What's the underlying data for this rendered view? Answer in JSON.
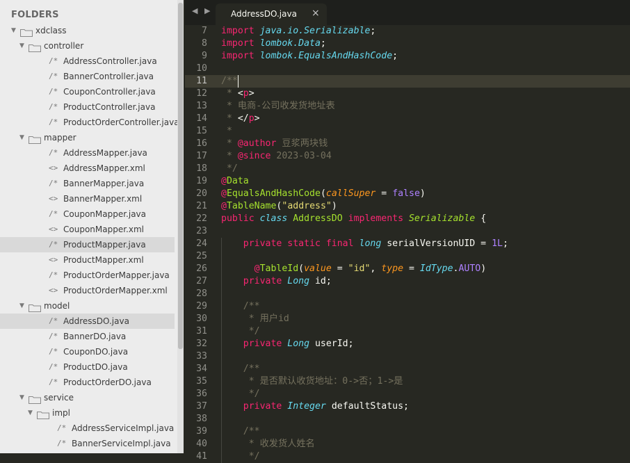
{
  "sidebar": {
    "title": "FOLDERS",
    "tree": [
      {
        "label": "xdclass",
        "kind": "folder",
        "depth": 0,
        "open": true
      },
      {
        "label": "controller",
        "kind": "folder",
        "depth": 1,
        "open": true
      },
      {
        "label": "AddressController.java",
        "kind": "java",
        "depth": 2
      },
      {
        "label": "BannerController.java",
        "kind": "java",
        "depth": 2
      },
      {
        "label": "CouponController.java",
        "kind": "java",
        "depth": 2
      },
      {
        "label": "ProductController.java",
        "kind": "java",
        "depth": 2
      },
      {
        "label": "ProductOrderController.java",
        "kind": "java",
        "depth": 2
      },
      {
        "label": "mapper",
        "kind": "folder",
        "depth": 1,
        "open": true
      },
      {
        "label": "AddressMapper.java",
        "kind": "java",
        "depth": 2
      },
      {
        "label": "AddressMapper.xml",
        "kind": "xml",
        "depth": 2
      },
      {
        "label": "BannerMapper.java",
        "kind": "java",
        "depth": 2
      },
      {
        "label": "BannerMapper.xml",
        "kind": "xml",
        "depth": 2
      },
      {
        "label": "CouponMapper.java",
        "kind": "java",
        "depth": 2
      },
      {
        "label": "CouponMapper.xml",
        "kind": "xml",
        "depth": 2
      },
      {
        "label": "ProductMapper.java",
        "kind": "java",
        "depth": 2,
        "highlighted": true
      },
      {
        "label": "ProductMapper.xml",
        "kind": "xml",
        "depth": 2
      },
      {
        "label": "ProductOrderMapper.java",
        "kind": "java",
        "depth": 2
      },
      {
        "label": "ProductOrderMapper.xml",
        "kind": "xml",
        "depth": 2
      },
      {
        "label": "model",
        "kind": "folder",
        "depth": 1,
        "open": true
      },
      {
        "label": "AddressDO.java",
        "kind": "java",
        "depth": 2,
        "highlighted": true
      },
      {
        "label": "BannerDO.java",
        "kind": "java",
        "depth": 2
      },
      {
        "label": "CouponDO.java",
        "kind": "java",
        "depth": 2
      },
      {
        "label": "ProductDO.java",
        "kind": "java",
        "depth": 2
      },
      {
        "label": "ProductOrderDO.java",
        "kind": "java",
        "depth": 2
      },
      {
        "label": "service",
        "kind": "folder",
        "depth": 1,
        "open": true
      },
      {
        "label": "impl",
        "kind": "folder",
        "depth": 2,
        "open": true
      },
      {
        "label": "AddressServiceImpl.java",
        "kind": "java",
        "depth": 3
      },
      {
        "label": "BannerServiceImpl.java",
        "kind": "java",
        "depth": 3
      }
    ],
    "icons": {
      "java": "/*",
      "xml": "<>",
      "folder": "folder-icon",
      "disclosure": "disclosure-open-icon"
    }
  },
  "tabbar": {
    "nav_glyphs": "◀ ▶",
    "active_tab": "AddressDO.java",
    "close_glyph": "×"
  },
  "editor": {
    "colors": {
      "background": "#272822",
      "text": "#f8f8f2",
      "keyword": "#f92672",
      "type": "#66d9ef",
      "comment": "#75715e",
      "string": "#e6db74",
      "number": "#ae81ff",
      "function": "#a6e22e",
      "param": "#fd971f"
    },
    "current_line": 11,
    "lines": [
      {
        "n": "7",
        "t": [
          [
            "import ",
            "kw"
          ],
          [
            "java.io.",
            "tyi"
          ],
          [
            "Serializable",
            "tyi"
          ],
          [
            ";",
            ""
          ]
        ]
      },
      {
        "n": "8",
        "t": [
          [
            "import ",
            "kw"
          ],
          [
            "lombok.",
            "tyi"
          ],
          [
            "Data",
            "tyi"
          ],
          [
            ";",
            ""
          ]
        ]
      },
      {
        "n": "9",
        "t": [
          [
            "import ",
            "kw"
          ],
          [
            "lombok.",
            "tyi"
          ],
          [
            "EqualsAndHashCode",
            "tyi"
          ],
          [
            ";",
            ""
          ]
        ]
      },
      {
        "n": "10",
        "t": []
      },
      {
        "n": "11",
        "t": [
          [
            "/**",
            "cm"
          ]
        ]
      },
      {
        "n": "12",
        "t": [
          [
            " * ",
            "cm"
          ],
          [
            "<",
            ""
          ],
          [
            "p",
            "kw"
          ],
          [
            ">",
            ""
          ]
        ]
      },
      {
        "n": "13",
        "t": [
          [
            " * 电商-公司收发货地址表",
            "cm"
          ]
        ]
      },
      {
        "n": "14",
        "t": [
          [
            " * ",
            "cm"
          ],
          [
            "</",
            ""
          ],
          [
            "p",
            "kw"
          ],
          [
            ">",
            ""
          ]
        ]
      },
      {
        "n": "15",
        "t": [
          [
            " *",
            "cm"
          ]
        ]
      },
      {
        "n": "16",
        "t": [
          [
            " * ",
            "cm"
          ],
          [
            "@author",
            "kw"
          ],
          [
            " 豆浆两块钱",
            "cm"
          ]
        ]
      },
      {
        "n": "17",
        "t": [
          [
            " * ",
            "cm"
          ],
          [
            "@since",
            "kw"
          ],
          [
            " 2023-03-04",
            "cm"
          ]
        ]
      },
      {
        "n": "18",
        "t": [
          [
            " */",
            "cm"
          ]
        ]
      },
      {
        "n": "19",
        "t": [
          [
            "@",
            "kw"
          ],
          [
            "Data",
            "fn"
          ]
        ]
      },
      {
        "n": "20",
        "t": [
          [
            "@",
            "kw"
          ],
          [
            "EqualsAndHashCode",
            "fn"
          ],
          [
            "(",
            ""
          ],
          [
            "callSuper",
            "pri"
          ],
          [
            " = ",
            ""
          ],
          [
            "false",
            "num"
          ],
          [
            ")",
            ""
          ]
        ]
      },
      {
        "n": "21",
        "t": [
          [
            "@",
            "kw"
          ],
          [
            "TableName",
            "fn"
          ],
          [
            "(",
            ""
          ],
          [
            "\"address\"",
            "str"
          ],
          [
            ")",
            ""
          ]
        ]
      },
      {
        "n": "22",
        "t": [
          [
            "public ",
            "kw"
          ],
          [
            "class ",
            "tyi"
          ],
          [
            "AddressDO ",
            "fn"
          ],
          [
            "implements ",
            "kw"
          ],
          [
            "Serializable",
            "fni"
          ],
          [
            " {",
            ""
          ]
        ]
      },
      {
        "n": "23",
        "t": []
      },
      {
        "n": "24",
        "t": [
          [
            "    private ",
            "kw"
          ],
          [
            "static ",
            "kw"
          ],
          [
            "final ",
            "kw"
          ],
          [
            "long ",
            "tyi"
          ],
          [
            "serialVersionUID = ",
            ""
          ],
          [
            "1L",
            "num"
          ],
          [
            ";",
            ""
          ]
        ]
      },
      {
        "n": "25",
        "t": []
      },
      {
        "n": "26",
        "t": [
          [
            "      @",
            "kw"
          ],
          [
            "TableId",
            "fn"
          ],
          [
            "(",
            ""
          ],
          [
            "value",
            "pri"
          ],
          [
            " = ",
            ""
          ],
          [
            "\"id\"",
            "str"
          ],
          [
            ", ",
            ""
          ],
          [
            "type",
            "pri"
          ],
          [
            " = ",
            ""
          ],
          [
            "IdType",
            "tyi"
          ],
          [
            ".",
            ""
          ],
          [
            "AUTO",
            "num"
          ],
          [
            ")",
            ""
          ]
        ]
      },
      {
        "n": "27",
        "t": [
          [
            "    private ",
            "kw"
          ],
          [
            "Long ",
            "tyi"
          ],
          [
            "id;",
            ""
          ]
        ]
      },
      {
        "n": "28",
        "t": []
      },
      {
        "n": "29",
        "t": [
          [
            "    /**",
            "cm"
          ]
        ]
      },
      {
        "n": "30",
        "t": [
          [
            "     * 用户id",
            "cm"
          ]
        ]
      },
      {
        "n": "31",
        "t": [
          [
            "     */",
            "cm"
          ]
        ]
      },
      {
        "n": "32",
        "t": [
          [
            "    private ",
            "kw"
          ],
          [
            "Long ",
            "tyi"
          ],
          [
            "userId;",
            ""
          ]
        ]
      },
      {
        "n": "33",
        "t": []
      },
      {
        "n": "34",
        "t": [
          [
            "    /**",
            "cm"
          ]
        ]
      },
      {
        "n": "35",
        "t": [
          [
            "     * 是否默认收货地址：0->否；1->是",
            "cm"
          ]
        ]
      },
      {
        "n": "36",
        "t": [
          [
            "     */",
            "cm"
          ]
        ]
      },
      {
        "n": "37",
        "t": [
          [
            "    private ",
            "kw"
          ],
          [
            "Integer ",
            "tyi"
          ],
          [
            "defaultStatus;",
            ""
          ]
        ]
      },
      {
        "n": "38",
        "t": []
      },
      {
        "n": "39",
        "t": [
          [
            "    /**",
            "cm"
          ]
        ]
      },
      {
        "n": "40",
        "t": [
          [
            "     * 收发货人姓名",
            "cm"
          ]
        ]
      },
      {
        "n": "41",
        "t": [
          [
            "     */",
            "cm"
          ]
        ]
      }
    ]
  }
}
